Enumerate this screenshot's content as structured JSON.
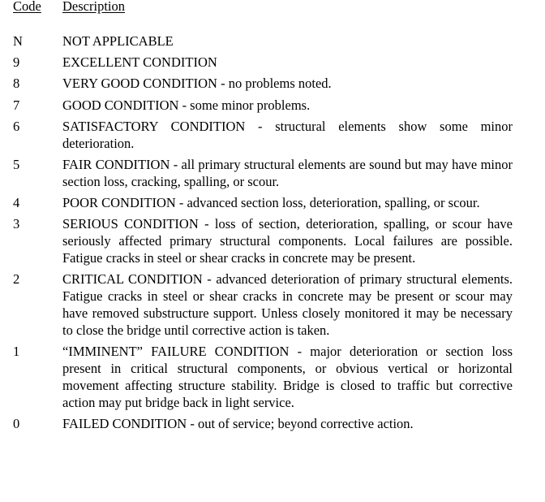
{
  "header": {
    "code": "Code",
    "description": "Description"
  },
  "rows": [
    {
      "code": "N",
      "description": "NOT APPLICABLE"
    },
    {
      "code": "9",
      "description": "EXCELLENT CONDITION"
    },
    {
      "code": "8",
      "description": "VERY GOOD CONDITION - no problems noted."
    },
    {
      "code": "7",
      "description": "GOOD CONDITION - some minor problems."
    },
    {
      "code": "6",
      "description": "SATISFACTORY CONDITION - structural elements show some minor deterioration."
    },
    {
      "code": "5",
      "description": "FAIR CONDITION - all primary structural elements are sound but may have minor section loss, cracking, spalling, or scour."
    },
    {
      "code": "4",
      "description": "POOR CONDITION - advanced section loss, deterioration, spalling, or scour."
    },
    {
      "code": "3",
      "description": "SERIOUS CONDITION - loss of section, deterioration, spalling, or scour have seriously affected primary structural components.  Local failures are possible.  Fatigue cracks in steel or shear cracks in concrete may be present."
    },
    {
      "code": "2",
      "description": "CRITICAL CONDITION - advanced deterioration of primary structural elements.  Fatigue cracks in steel or shear cracks in concrete may be present or scour may have removed substructure support.  Unless closely monitored it may be necessary to close the bridge until corrective action is taken."
    },
    {
      "code": "1",
      "description": "“IMMINENT” FAILURE CONDITION - major deterioration or section loss present in critical structural components, or obvious vertical or horizontal movement affecting structure stability.  Bridge is closed to traffic but corrective action may put bridge back in light service."
    },
    {
      "code": "0",
      "description": "FAILED CONDITION - out of service; beyond corrective action."
    }
  ]
}
